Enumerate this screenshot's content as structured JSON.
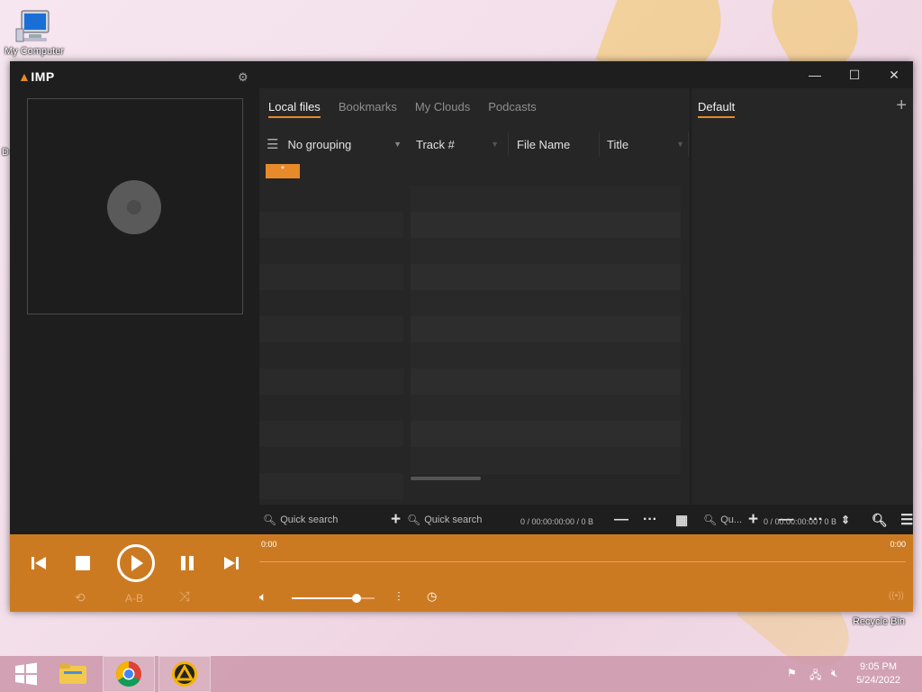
{
  "desktop": {
    "my_computer_label": "My Computer",
    "recycle_bin_label": "Recycle Bin",
    "stray_label": "D"
  },
  "app": {
    "logo_prefix": "▲",
    "logo_text": "IMP",
    "window_controls": {
      "minimize": "—",
      "maximize": "☐",
      "close": "✕"
    }
  },
  "library_tabs": [
    {
      "label": "Local files",
      "active": true
    },
    {
      "label": "Bookmarks",
      "active": false
    },
    {
      "label": "My Clouds",
      "active": false
    },
    {
      "label": "Podcasts",
      "active": false
    }
  ],
  "grouping": {
    "label": "No grouping"
  },
  "columns": {
    "track": "Track #",
    "file_name": "File Name",
    "title": "Title"
  },
  "group_badge": "*",
  "library_stats": "0 / 00:00:00:00 / 0 B",
  "playlist": {
    "tab_label": "Default",
    "stats": "0 / 00:00:00:00 / 0 B",
    "add_symbol": "+"
  },
  "search": {
    "groups_placeholder": "Quick search",
    "list_placeholder": "Quick search",
    "playlist_placeholder": "Qu..."
  },
  "player": {
    "time_elapsed": "0:00",
    "time_total": "0:00",
    "ab_label": "A-B",
    "volume": 0.78
  },
  "taskbar": {
    "time": "9:05 PM",
    "date": "5/24/2022"
  },
  "colors": {
    "accent": "#e8892a",
    "panel": "#cc7a22",
    "window_bg": "#1e1e1e"
  }
}
